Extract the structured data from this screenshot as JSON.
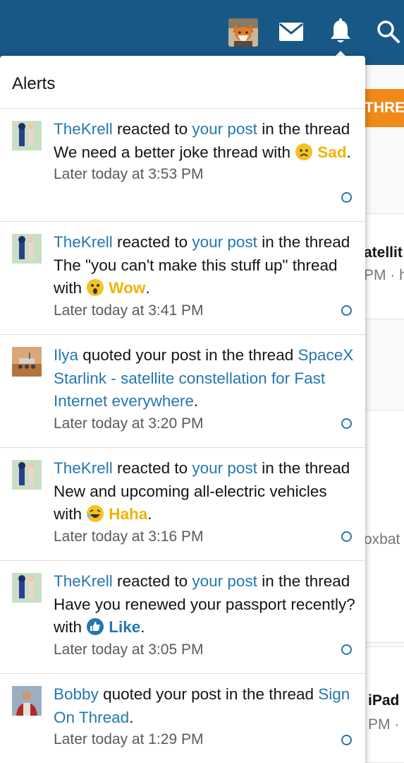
{
  "popup": {
    "title": "Alerts"
  },
  "background": {
    "thread_button": "THREA",
    "snippets": [
      "atellit",
      "PM · h",
      "oxbat",
      "iPad",
      "PM ·"
    ]
  },
  "alerts": [
    {
      "avatar": "robot-figure-avatar",
      "user": "TheKrell",
      "verb": " reacted to ",
      "target": "your post",
      "pre_thread": " in the thread ",
      "thread": "We need a better joke thread",
      "with": " with ",
      "reaction": {
        "icon": "sad-emoji-icon",
        "label": "Sad",
        "color": "#f0b400"
      },
      "time": "Later today at 3:53 PM"
    },
    {
      "avatar": "robot-figure-avatar",
      "user": "TheKrell",
      "verb": " reacted to ",
      "target": "your post",
      "pre_thread": " in the thread ",
      "thread": "The \"you can't make this stuff up\" thread",
      "with": " with ",
      "reaction": {
        "icon": "wow-emoji-icon",
        "label": "Wow",
        "color": "#f0b400"
      },
      "time": "Later today at 3:41 PM"
    },
    {
      "avatar": "mars-rover-avatar",
      "user": "Ilya",
      "verb": " quoted your post in the thread ",
      "thread_link": "SpaceX Starlink - satellite constellation for Fast Internet everywhere",
      "suffix": ".",
      "time": "Later today at 3:20 PM"
    },
    {
      "avatar": "robot-figure-avatar",
      "user": "TheKrell",
      "verb": " reacted to ",
      "target": "your post",
      "pre_thread": " in the thread ",
      "thread": "New and upcoming all-electric vehicles",
      "with": " with ",
      "reaction": {
        "icon": "haha-emoji-icon",
        "label": "Haha",
        "color": "#f0b400"
      },
      "time": "Later today at 3:16 PM"
    },
    {
      "avatar": "robot-figure-avatar",
      "user": "TheKrell",
      "verb": " reacted to ",
      "target": "your post",
      "pre_thread": " in the thread ",
      "thread": "Have you renewed your passport recently?",
      "with": " with ",
      "reaction": {
        "icon": "like-thumb-icon",
        "label": "Like",
        "color": "#2577b1"
      },
      "time": "Later today at 3:05 PM"
    },
    {
      "avatar": "person-photo-avatar",
      "user": "Bobby",
      "verb": " quoted your post in the thread ",
      "thread_link": "Sign On Thread",
      "suffix": ".",
      "time": "Later today at 1:29 PM"
    }
  ],
  "topbar": {
    "icons": [
      "fox-avatar",
      "mail-icon",
      "bell-icon",
      "search-icon"
    ],
    "color": "#185886"
  }
}
